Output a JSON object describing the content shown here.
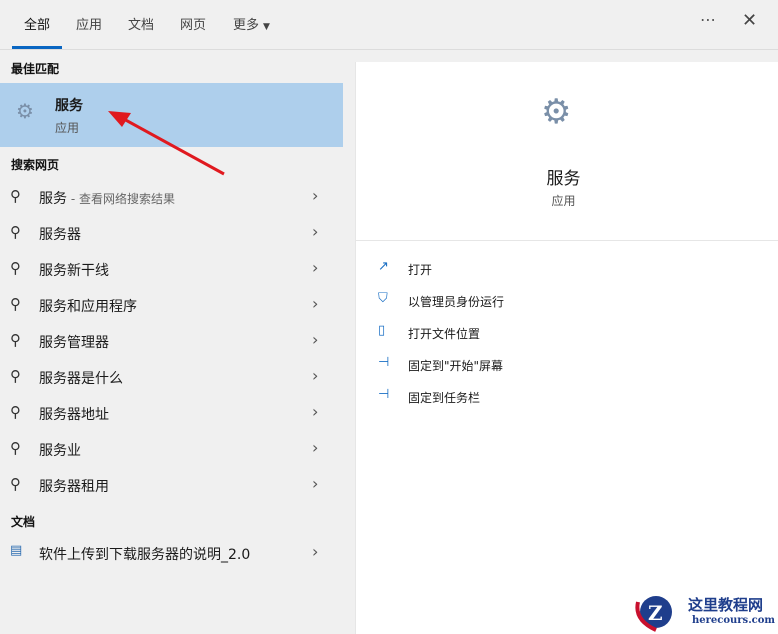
{
  "tabs": [
    {
      "label": "全部"
    },
    {
      "label": "应用"
    },
    {
      "label": "文档"
    },
    {
      "label": "网页"
    },
    {
      "label": "更多"
    }
  ],
  "icons": {
    "more": "⋯",
    "close": "✕"
  },
  "sections": {
    "best": "最佳匹配",
    "web": "搜索网页",
    "docs": "文档"
  },
  "best_match": {
    "title": "服务",
    "subtitle": "应用"
  },
  "web_results": [
    {
      "label": "服务",
      "sub": " - 查看网络搜索结果"
    },
    {
      "label": "服务器",
      "sub": ""
    },
    {
      "label": "服务新干线",
      "sub": ""
    },
    {
      "label": "服务和应用程序",
      "sub": ""
    },
    {
      "label": "服务管理器",
      "sub": ""
    },
    {
      "label": "服务器是什么",
      "sub": ""
    },
    {
      "label": "服务器地址",
      "sub": ""
    },
    {
      "label": "服务业",
      "sub": ""
    },
    {
      "label": "服务器租用",
      "sub": ""
    }
  ],
  "documents": [
    {
      "label": "软件上传到下载服务器的说明_2.0"
    }
  ],
  "detail": {
    "title": "服务",
    "subtitle": "应用",
    "actions": [
      {
        "label": "打开"
      },
      {
        "label": "以管理员身份运行"
      },
      {
        "label": "打开文件位置"
      },
      {
        "label": "固定到\"开始\"屏幕"
      },
      {
        "label": "固定到任务栏"
      }
    ]
  },
  "watermark": {
    "name": "这里教程网",
    "url": "herecours.com"
  },
  "colors": {
    "accent": "#0a66c2",
    "selected": "#aecfec",
    "arrow": "#e0191f"
  }
}
